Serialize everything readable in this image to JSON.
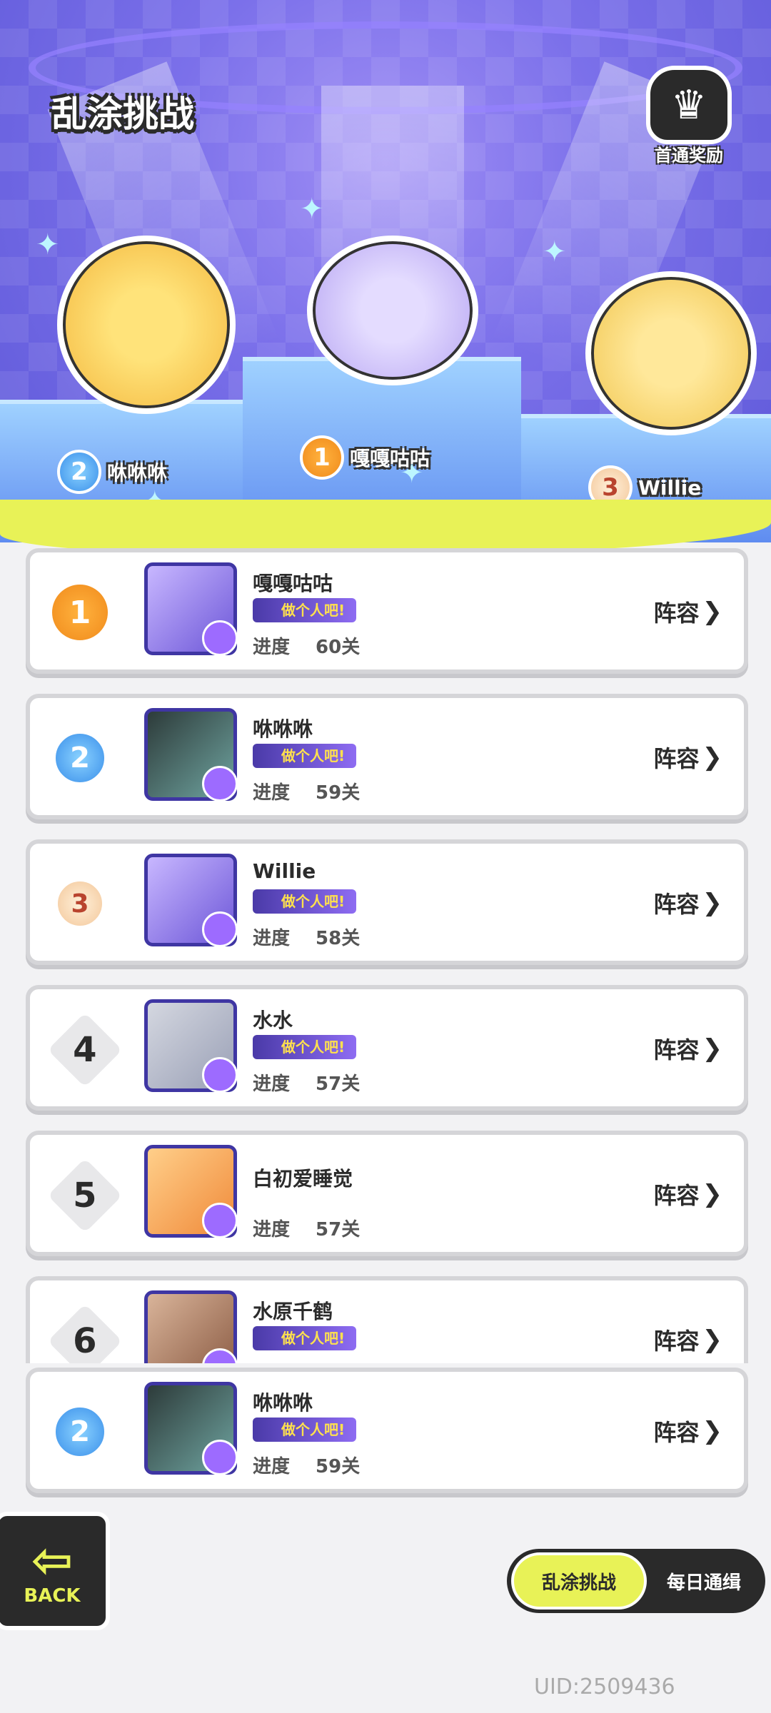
{
  "title": "乱涂挑战",
  "reward": {
    "label": "首通奖励",
    "icon": "shield-crown-icon"
  },
  "podium": [
    {
      "rank": "2",
      "name": "咻咻咻"
    },
    {
      "rank": "1",
      "name": "嘎嘎咕咕"
    },
    {
      "rank": "3",
      "name": "Willie"
    }
  ],
  "tag_label": "做个人吧!",
  "progress_label": "进度",
  "lineup_label": "阵容",
  "ranking": [
    {
      "rank": "1",
      "name": "嘎嘎咕咕",
      "progress": "60关",
      "tag": "做个人吧!"
    },
    {
      "rank": "2",
      "name": "咻咻咻",
      "progress": "59关",
      "tag": "做个人吧!"
    },
    {
      "rank": "3",
      "name": "Willie",
      "progress": "58关",
      "tag": "做个人吧!"
    },
    {
      "rank": "4",
      "name": "水水",
      "progress": "57关",
      "tag": "做个人吧!"
    },
    {
      "rank": "5",
      "name": "白初爱睡觉",
      "progress": "57关"
    },
    {
      "rank": "6",
      "name": "水原千鹤",
      "progress": "",
      "tag": "做个人吧!"
    }
  ],
  "my_rank": {
    "rank": "2",
    "name": "咻咻咻",
    "progress": "59关",
    "tag": "做个人吧!"
  },
  "back_label": "BACK",
  "tabs": [
    {
      "label": "乱涂挑战",
      "active": true
    },
    {
      "label": "每日通缉",
      "active": false
    }
  ],
  "uid": "UID:2509436",
  "colors": {
    "accent": "#e8f257",
    "hero_bg": "#7b70ea",
    "dark": "#2a2a2a"
  }
}
